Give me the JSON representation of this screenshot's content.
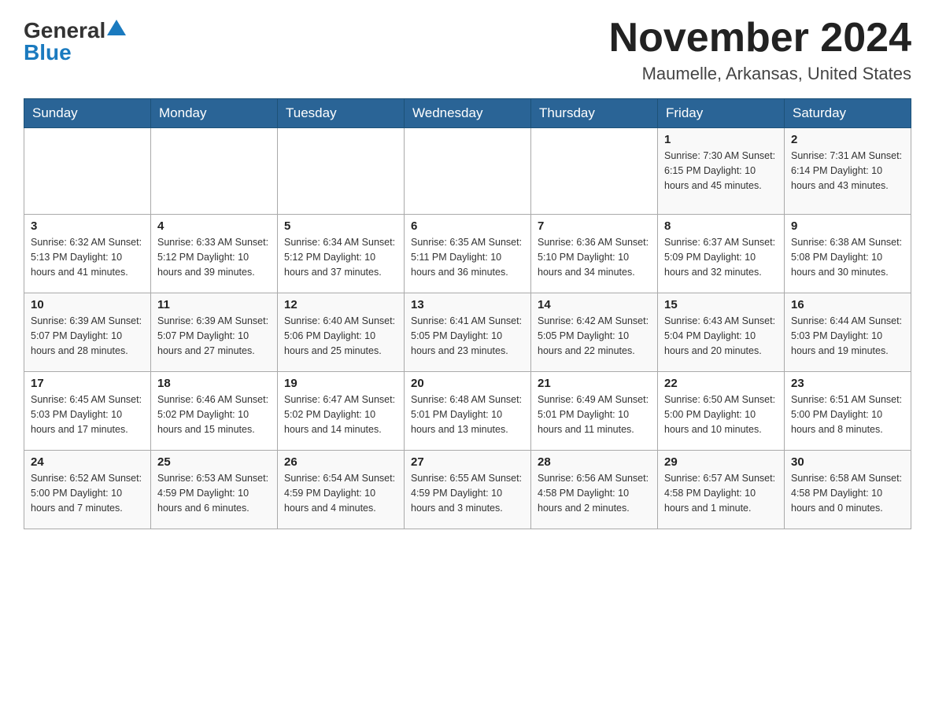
{
  "header": {
    "logo_general": "General",
    "logo_blue": "Blue",
    "month_title": "November 2024",
    "location": "Maumelle, Arkansas, United States"
  },
  "days_of_week": [
    "Sunday",
    "Monday",
    "Tuesday",
    "Wednesday",
    "Thursday",
    "Friday",
    "Saturday"
  ],
  "weeks": [
    [
      {
        "day": "",
        "info": ""
      },
      {
        "day": "",
        "info": ""
      },
      {
        "day": "",
        "info": ""
      },
      {
        "day": "",
        "info": ""
      },
      {
        "day": "",
        "info": ""
      },
      {
        "day": "1",
        "info": "Sunrise: 7:30 AM\nSunset: 6:15 PM\nDaylight: 10 hours and 45 minutes."
      },
      {
        "day": "2",
        "info": "Sunrise: 7:31 AM\nSunset: 6:14 PM\nDaylight: 10 hours and 43 minutes."
      }
    ],
    [
      {
        "day": "3",
        "info": "Sunrise: 6:32 AM\nSunset: 5:13 PM\nDaylight: 10 hours and 41 minutes."
      },
      {
        "day": "4",
        "info": "Sunrise: 6:33 AM\nSunset: 5:12 PM\nDaylight: 10 hours and 39 minutes."
      },
      {
        "day": "5",
        "info": "Sunrise: 6:34 AM\nSunset: 5:12 PM\nDaylight: 10 hours and 37 minutes."
      },
      {
        "day": "6",
        "info": "Sunrise: 6:35 AM\nSunset: 5:11 PM\nDaylight: 10 hours and 36 minutes."
      },
      {
        "day": "7",
        "info": "Sunrise: 6:36 AM\nSunset: 5:10 PM\nDaylight: 10 hours and 34 minutes."
      },
      {
        "day": "8",
        "info": "Sunrise: 6:37 AM\nSunset: 5:09 PM\nDaylight: 10 hours and 32 minutes."
      },
      {
        "day": "9",
        "info": "Sunrise: 6:38 AM\nSunset: 5:08 PM\nDaylight: 10 hours and 30 minutes."
      }
    ],
    [
      {
        "day": "10",
        "info": "Sunrise: 6:39 AM\nSunset: 5:07 PM\nDaylight: 10 hours and 28 minutes."
      },
      {
        "day": "11",
        "info": "Sunrise: 6:39 AM\nSunset: 5:07 PM\nDaylight: 10 hours and 27 minutes."
      },
      {
        "day": "12",
        "info": "Sunrise: 6:40 AM\nSunset: 5:06 PM\nDaylight: 10 hours and 25 minutes."
      },
      {
        "day": "13",
        "info": "Sunrise: 6:41 AM\nSunset: 5:05 PM\nDaylight: 10 hours and 23 minutes."
      },
      {
        "day": "14",
        "info": "Sunrise: 6:42 AM\nSunset: 5:05 PM\nDaylight: 10 hours and 22 minutes."
      },
      {
        "day": "15",
        "info": "Sunrise: 6:43 AM\nSunset: 5:04 PM\nDaylight: 10 hours and 20 minutes."
      },
      {
        "day": "16",
        "info": "Sunrise: 6:44 AM\nSunset: 5:03 PM\nDaylight: 10 hours and 19 minutes."
      }
    ],
    [
      {
        "day": "17",
        "info": "Sunrise: 6:45 AM\nSunset: 5:03 PM\nDaylight: 10 hours and 17 minutes."
      },
      {
        "day": "18",
        "info": "Sunrise: 6:46 AM\nSunset: 5:02 PM\nDaylight: 10 hours and 15 minutes."
      },
      {
        "day": "19",
        "info": "Sunrise: 6:47 AM\nSunset: 5:02 PM\nDaylight: 10 hours and 14 minutes."
      },
      {
        "day": "20",
        "info": "Sunrise: 6:48 AM\nSunset: 5:01 PM\nDaylight: 10 hours and 13 minutes."
      },
      {
        "day": "21",
        "info": "Sunrise: 6:49 AM\nSunset: 5:01 PM\nDaylight: 10 hours and 11 minutes."
      },
      {
        "day": "22",
        "info": "Sunrise: 6:50 AM\nSunset: 5:00 PM\nDaylight: 10 hours and 10 minutes."
      },
      {
        "day": "23",
        "info": "Sunrise: 6:51 AM\nSunset: 5:00 PM\nDaylight: 10 hours and 8 minutes."
      }
    ],
    [
      {
        "day": "24",
        "info": "Sunrise: 6:52 AM\nSunset: 5:00 PM\nDaylight: 10 hours and 7 minutes."
      },
      {
        "day": "25",
        "info": "Sunrise: 6:53 AM\nSunset: 4:59 PM\nDaylight: 10 hours and 6 minutes."
      },
      {
        "day": "26",
        "info": "Sunrise: 6:54 AM\nSunset: 4:59 PM\nDaylight: 10 hours and 4 minutes."
      },
      {
        "day": "27",
        "info": "Sunrise: 6:55 AM\nSunset: 4:59 PM\nDaylight: 10 hours and 3 minutes."
      },
      {
        "day": "28",
        "info": "Sunrise: 6:56 AM\nSunset: 4:58 PM\nDaylight: 10 hours and 2 minutes."
      },
      {
        "day": "29",
        "info": "Sunrise: 6:57 AM\nSunset: 4:58 PM\nDaylight: 10 hours and 1 minute."
      },
      {
        "day": "30",
        "info": "Sunrise: 6:58 AM\nSunset: 4:58 PM\nDaylight: 10 hours and 0 minutes."
      }
    ]
  ]
}
